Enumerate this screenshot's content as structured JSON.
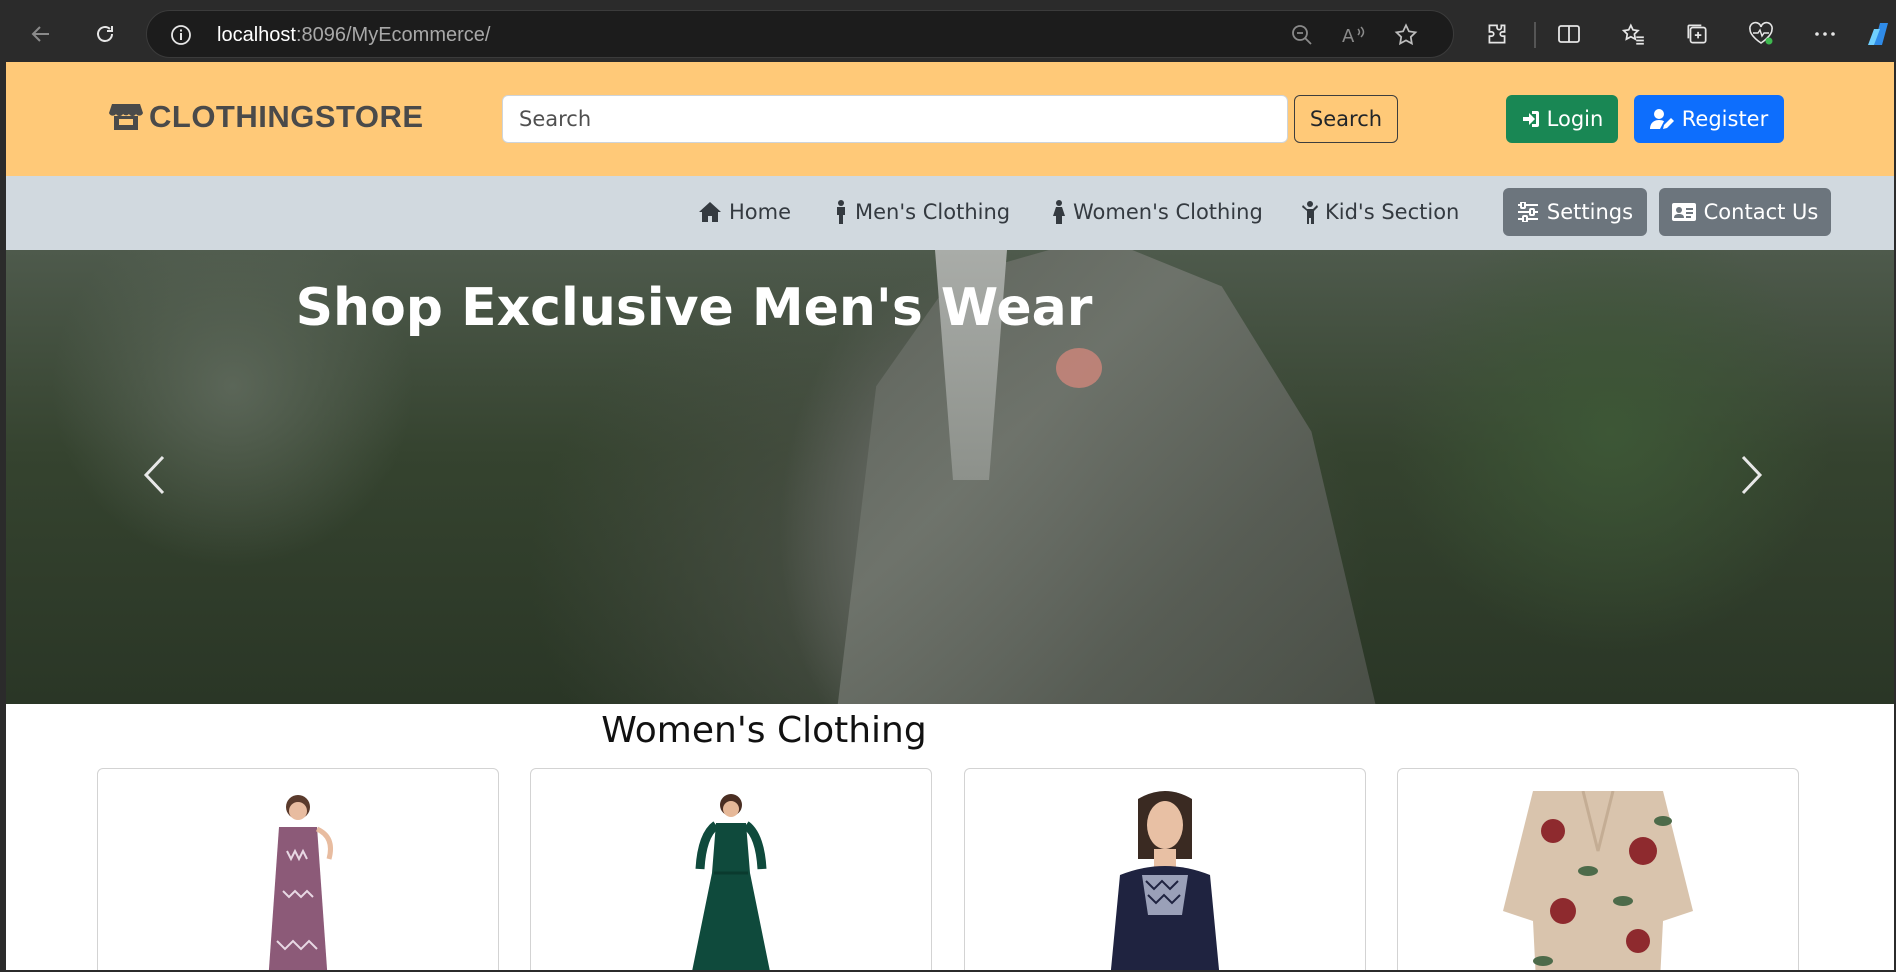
{
  "browser": {
    "url_host": "localhost",
    "url_rest": ":8096/MyEcommerce/"
  },
  "header": {
    "brand": "CLOTHINGSTORE",
    "search_placeholder": "Search",
    "search_button": "Search",
    "login": "Login",
    "register": "Register"
  },
  "nav": {
    "links": [
      "Home",
      "Men's Clothing",
      "Women's Clothing",
      "Kid's Section"
    ],
    "settings": "Settings",
    "contact": "Contact Us"
  },
  "hero": {
    "title": "Shop Exclusive Men's Wear"
  },
  "section": {
    "title": "Women's Clothing",
    "products": [
      {
        "color": "#8c5a78"
      },
      {
        "color": "#0f4a3c"
      },
      {
        "color": "#1f2340"
      },
      {
        "color": "#d9c4ad"
      }
    ]
  }
}
